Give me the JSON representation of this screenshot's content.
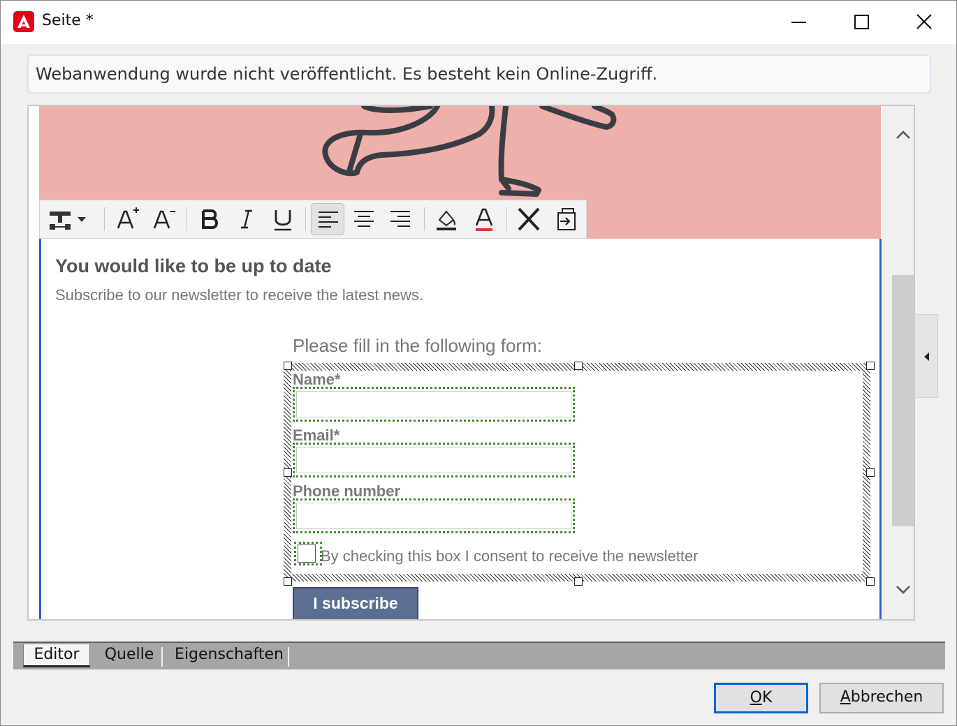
{
  "window": {
    "title": "Seite *",
    "accent": "#e3001b"
  },
  "info_bar": {
    "message": "Webanwendung wurde nicht veröffentlicht. Es besteht kein Online-Zugriff."
  },
  "format_toolbar": {
    "buttons": [
      "insert-icon",
      "font-size-increase-icon",
      "font-size-decrease-icon",
      "bold-icon",
      "italic-icon",
      "underline-icon",
      "align-left-icon",
      "align-center-icon",
      "align-right-icon",
      "fill-color-icon",
      "font-color-icon",
      "delete-icon",
      "insert-field-icon"
    ],
    "active": "align-left-icon"
  },
  "content": {
    "banner_color": "#eeb0ab",
    "heading": "You would like to be up to date",
    "subtext": "Subscribe to our newsletter to receive the latest news.",
    "form_title": "Please fill in the following form:",
    "fields": [
      {
        "label": "Name*",
        "value": ""
      },
      {
        "label": "Email*",
        "value": ""
      },
      {
        "label": "Phone number",
        "value": ""
      }
    ],
    "consent_label": "By checking this box I consent to receive the newsletter",
    "consent_checked": false,
    "submit_label": "I subscribe",
    "submit_color": "#5a6f92"
  },
  "tabs": {
    "items": [
      "Editor",
      "Quelle",
      "Eigenschaften"
    ],
    "active": "Editor"
  },
  "buttons": {
    "ok": {
      "pre": "",
      "accel": "O",
      "post": "K"
    },
    "cancel": {
      "pre": "",
      "accel": "A",
      "post": "bbrechen"
    }
  }
}
